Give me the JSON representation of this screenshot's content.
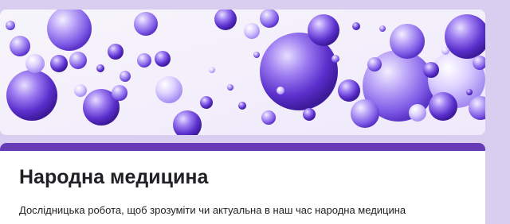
{
  "form": {
    "title": "Народна медицина",
    "description": "Дослідницька робота, щоб зрозуміти чи актуальна в наш час народна медицина"
  },
  "colors": {
    "page_background": "#d9cdf0",
    "accent": "#673ab7",
    "text": "#202124"
  },
  "banner": {
    "image": "purple-bubbles-header-image"
  }
}
